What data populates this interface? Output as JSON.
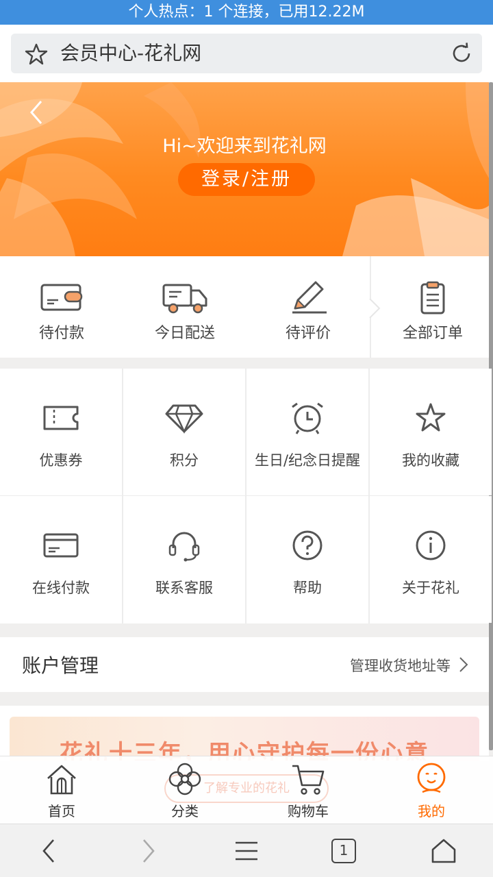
{
  "status_bar": {
    "text": "个人热点：1 个连接，已用12.22M"
  },
  "address_bar": {
    "title": "会员中心-花礼网"
  },
  "hero": {
    "welcome": "Hi~欢迎来到花礼网",
    "login_button": "登录/注册"
  },
  "orders": [
    {
      "label": "待付款",
      "icon": "wallet-icon"
    },
    {
      "label": "今日配送",
      "icon": "truck-icon"
    },
    {
      "label": "待评价",
      "icon": "pen-icon"
    },
    {
      "label": "全部订单",
      "icon": "clipboard-icon"
    }
  ],
  "grid": [
    {
      "label": "优惠券",
      "icon": "coupon-icon"
    },
    {
      "label": "积分",
      "icon": "diamond-icon"
    },
    {
      "label": "生日/纪念日提醒",
      "icon": "alarm-clock-icon"
    },
    {
      "label": "我的收藏",
      "icon": "star-icon"
    },
    {
      "label": "在线付款",
      "icon": "card-icon"
    },
    {
      "label": "联系客服",
      "icon": "headset-icon"
    },
    {
      "label": "帮助",
      "icon": "question-icon"
    },
    {
      "label": "关于花礼",
      "icon": "info-icon"
    }
  ],
  "account": {
    "title": "账户管理",
    "subtitle": "管理收货地址等"
  },
  "banner": {
    "text": "花礼十三年，用心守护每一份心意",
    "pill": "了解专业的花礼"
  },
  "tabbar": [
    {
      "label": "首页",
      "icon": "home-icon"
    },
    {
      "label": "分类",
      "icon": "flower-icon"
    },
    {
      "label": "购物车",
      "icon": "cart-icon"
    },
    {
      "label": "我的",
      "icon": "smiley-icon"
    }
  ],
  "browser_nav": {
    "tab_count": "1"
  },
  "colors": {
    "accent": "#ff6a00",
    "status_bar": "#3f8fde",
    "hero_orange": "#ff8a20"
  }
}
